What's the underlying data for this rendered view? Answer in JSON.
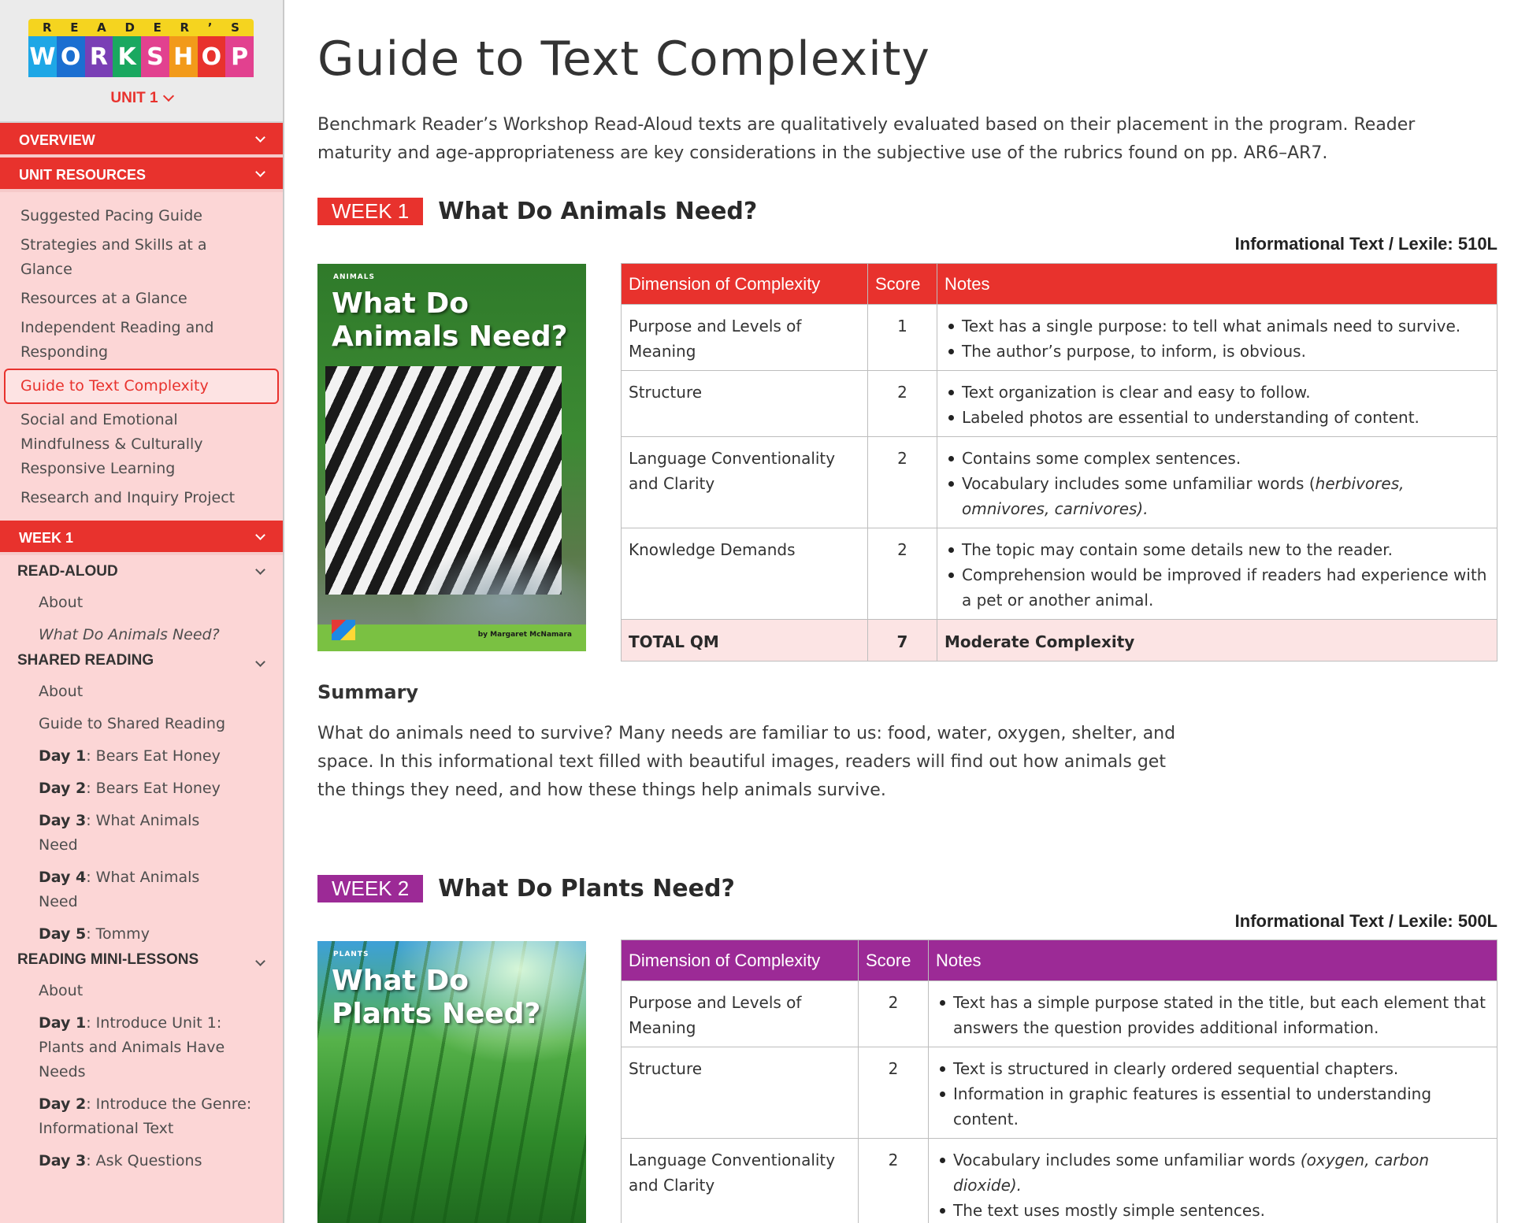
{
  "colors": {
    "red": "#e8322d",
    "purple": "#9c2a96",
    "sidebar_bg": "#fcd6d6",
    "total_row": "#fce4e4"
  },
  "logo": {
    "top_letters": [
      "R",
      "E",
      "A",
      "D",
      "E",
      "R",
      "’",
      "S"
    ],
    "tiles": [
      {
        "letter": "W",
        "color": "#1ea7e6"
      },
      {
        "letter": "O",
        "color": "#1b6fd1"
      },
      {
        "letter": "R",
        "color": "#7a3fb5"
      },
      {
        "letter": "K",
        "color": "#1aa860"
      },
      {
        "letter": "S",
        "color": "#e2418f"
      },
      {
        "letter": "H",
        "color": "#f29a1a"
      },
      {
        "letter": "O",
        "color": "#e8322d"
      },
      {
        "letter": "P",
        "color": "#e2418f"
      }
    ]
  },
  "sidebar": {
    "unit_label": "UNIT 1",
    "overview": "OVERVIEW",
    "unit_resources": "UNIT RESOURCES",
    "resources": [
      "Suggested Pacing Guide",
      "Strategies and Skills at a Glance",
      "Resources at a Glance",
      "Independent Reading and Responding",
      "Guide to Text Complexity",
      "Social and Emotional Mindfulness & Culturally Responsive Learning",
      "Research and Inquiry Project"
    ],
    "week1": "WEEK 1",
    "read_aloud": "READ-ALOUD",
    "read_aloud_items": [
      "About",
      "What Do Animals Need?"
    ],
    "shared_reading": "SHARED READING",
    "shared_items": [
      "About",
      "Guide to Shared Reading"
    ],
    "shared_days": [
      {
        "day": "Day 1",
        "text": ": Bears Eat Honey"
      },
      {
        "day": "Day 2",
        "text": ": Bears Eat Honey"
      },
      {
        "day": "Day 3",
        "text": ": What Animals Need"
      },
      {
        "day": "Day 4",
        "text": ": What Animals Need"
      },
      {
        "day": "Day 5",
        "text": ": Tommy"
      }
    ],
    "mini_lessons": "READING MINI-LESSONS",
    "mini_about": "About",
    "mini_days": [
      {
        "day": "Day 1",
        "text": ": Introduce Unit 1: Plants and Animals Have Needs"
      },
      {
        "day": "Day 2",
        "text": ": Introduce the Genre: Informational Text"
      },
      {
        "day": "Day 3",
        "text": ": Ask Questions"
      }
    ]
  },
  "main": {
    "title": "Guide to Text Complexity",
    "intro": "Benchmark Reader’s Workshop Read-Aloud texts are qualitatively evaluated based on their placement in the program. Reader maturity and age-appropriateness are key considerations in the subjective use of the rubrics found on pp. AR6–AR7.",
    "table_headers": {
      "dimension": "Dimension of Complexity",
      "score": "Score",
      "notes": "Notes"
    },
    "summary_heading": "Summary",
    "week1": {
      "badge": "WEEK 1",
      "title": "What Do Animals Need?",
      "lexile": "Informational Text / Lexile: 510L",
      "cover": {
        "series": "ANIMALS",
        "title": "What Do Animals Need?",
        "author": "by Margaret McNamara"
      },
      "rows": [
        {
          "dimension": "Purpose and Levels of Meaning",
          "score": "1",
          "notes": [
            "Text has a single purpose: to tell what animals need to survive.",
            "The author’s purpose, to inform, is obvious."
          ]
        },
        {
          "dimension": "Structure",
          "score": "2",
          "notes": [
            "Text organization is clear and easy to follow.",
            "Labeled photos are essential to understanding of content."
          ]
        },
        {
          "dimension": "Language Conventionality and Clarity",
          "score": "2",
          "notes": [
            "Contains some complex sentences.",
            "Vocabulary includes some unfamiliar words (",
            "herbivores, omnivores, carnivores).",
            ""
          ]
        },
        {
          "dimension": "Knowledge Demands",
          "score": "2",
          "notes": [
            "The topic may contain some details new to the reader.",
            "Comprehension would be improved if readers had experience with a pet or another animal."
          ]
        }
      ],
      "total": {
        "label": "TOTAL QM",
        "score": "7",
        "result": "Moderate Complexity"
      },
      "summary": "What do animals need to survive? Many needs are familiar to us: food, water, oxygen, shelter, and space. In this informational text filled with beautiful images, readers will find out how animals get the things they need, and how these things help animals survive."
    },
    "week2": {
      "badge": "WEEK 2",
      "title": "What Do Plants Need?",
      "lexile": "Informational Text / Lexile: 500L",
      "cover": {
        "series": "PLANTS",
        "title": "What Do Plants Need?"
      },
      "rows": [
        {
          "dimension": "Purpose and Levels of Meaning",
          "score": "2",
          "notes": [
            "Text has a simple purpose stated in the title, but each element that answers the question provides additional information."
          ]
        },
        {
          "dimension": "Structure",
          "score": "2",
          "notes": [
            "Text is structured in clearly ordered sequential chapters.",
            "Information in graphic features is essential to understanding content."
          ]
        },
        {
          "dimension": "Language Conventionality and Clarity",
          "score": "2",
          "notes": [
            "Vocabulary includes some unfamiliar words ",
            "(oxygen, carbon dioxide).",
            "The text uses mostly simple sentences."
          ]
        }
      ]
    }
  }
}
